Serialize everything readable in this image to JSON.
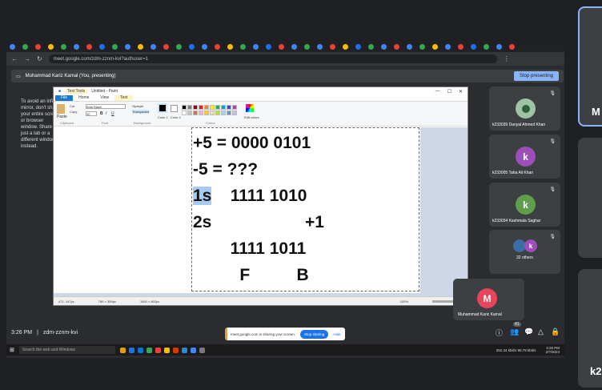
{
  "right_strip": {
    "top_label": "M",
    "bottom_label": "k2"
  },
  "chrome": {
    "url": "meet.google.com/zdm-zznm-kvi?authuser=1",
    "tab_colors": [
      "#4285f4",
      "#34a853",
      "#ea4335",
      "#fbbc04",
      "#34a853",
      "#4285f4",
      "#ea4335",
      "#1a73e8",
      "#34a853",
      "#4285f4",
      "#fbbc04",
      "#4285f4",
      "#ea4335",
      "#34a853",
      "#1a73e8",
      "#4285f4",
      "#ea4335",
      "#fbbc04",
      "#34a853",
      "#4285f4",
      "#1a73e8",
      "#ea4335",
      "#4285f4",
      "#34a853",
      "#4285f4",
      "#ea4335",
      "#fbbc04",
      "#1a73e8",
      "#34a853",
      "#4285f4",
      "#ea4335",
      "#4285f4",
      "#34a853",
      "#fbbc04",
      "#4285f4",
      "#ea4335",
      "#1a73e8",
      "#34a853",
      "#4285f4",
      "#ea4335"
    ]
  },
  "presenting": {
    "text": "Muhammad Kariz Kamal (You, presenting)",
    "button": "Stop presenting"
  },
  "notice": "To avoid an infinity mirror, don't share your entire screen or browser window. Share just a tab or a different window instead.",
  "paint": {
    "title": "Untitled - Paint",
    "tab_text_tools": "Text Tools",
    "menu": [
      "File",
      "Home",
      "View",
      "Text"
    ],
    "ribbon": {
      "cut": "Cut",
      "copy": "Copy",
      "paste": "Paste",
      "font": "Arial Black",
      "size": "40",
      "opaque": "Opaque",
      "transparent": "Transparent",
      "color1": "Color 1",
      "color2": "Color 2",
      "edit_colors": "Edit colors",
      "groups": [
        "Clipboard",
        "Font",
        "Background",
        "Colors"
      ]
    },
    "palette": [
      "#000000",
      "#7f7f7f",
      "#880015",
      "#ed1c24",
      "#ff7f27",
      "#fff200",
      "#22b14c",
      "#00a2e8",
      "#3f48cc",
      "#a349a4",
      "#ffffff",
      "#c3c3c3",
      "#b97a57",
      "#ffaec9",
      "#ffc90e",
      "#efe4b0",
      "#b5e61d",
      "#99d9ea",
      "#7092be",
      "#c8bfe7"
    ],
    "lines": [
      {
        "pre": "",
        "hl": "",
        "text": "+5 = 0000 0101"
      },
      {
        "pre": "",
        "hl": "",
        "text": "-5 = ???"
      },
      {
        "pre": "",
        "hl": "1s",
        "text": "    1111 1010"
      },
      {
        "pre": "",
        "hl": "",
        "text": "2s                    +1"
      },
      {
        "pre": "",
        "hl": "",
        "text": "        1111 1011"
      },
      {
        "pre": "",
        "hl": "",
        "text": "          F          B"
      }
    ],
    "status": {
      "cursor": "471, 147px",
      "selection": "789 × 359px",
      "size": "1450 × 802px",
      "zoom": "100%"
    }
  },
  "participants": [
    {
      "name": "k233039 Danyal Ahmed Khan",
      "initial": "",
      "color": "#9fc3a5",
      "photo": true
    },
    {
      "name": "k233005 Taha Ali Khan",
      "initial": "k",
      "color": "#9c4fb8"
    },
    {
      "name": "k233034 Kashmala Saghar",
      "initial": "k",
      "color": "#5f9e4c"
    },
    {
      "name": "32 others",
      "initial": "k",
      "color": "#9c4fb8",
      "group": true
    },
    {
      "name": "Muhammad Kariz Kamal",
      "initial": "M",
      "color": "#e8455c"
    }
  ],
  "meeting": {
    "time": "3:26 PM",
    "code": "zdm-zznm-kvi",
    "raise_count": "41"
  },
  "share_notice": {
    "text": "meet.google.com is sharing your screen.",
    "stop": "Stop sharing",
    "hide": "Hide"
  },
  "taskbar": {
    "search": "Search the web and Windows",
    "network": "252.34 kbit/s  90.79 kbit/s",
    "time": "3:26 PM",
    "date": "2/7/2024",
    "icon_colors": [
      "#e0a200",
      "#1a73e8",
      "#0078d7",
      "#34a853",
      "#ea4335",
      "#fbbc04",
      "#d83b01",
      "#2b88d8",
      "#4285f4",
      "#7a7a7a"
    ]
  }
}
